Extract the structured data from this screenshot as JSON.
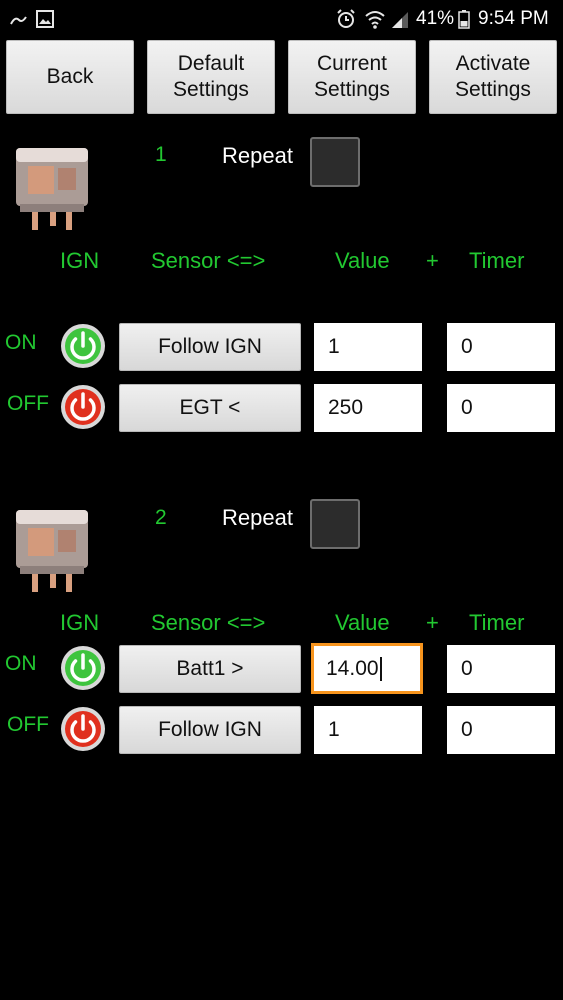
{
  "status_bar": {
    "battery_percent": "41%",
    "time": "9:54 PM",
    "icons": [
      "notification-icon",
      "image-icon",
      "alarm-icon",
      "wifi-icon",
      "signal-icon",
      "battery-icon"
    ]
  },
  "toolbar": {
    "back_label": "Back",
    "default_line1": "Default",
    "default_line2": "Settings",
    "current_line1": "Current",
    "current_line2": "Settings",
    "activate_line1": "Activate",
    "activate_line2": "Settings"
  },
  "colors": {
    "accent_green": "#22c831",
    "focus_orange": "#f7941d",
    "on_icon": "#3ec43e",
    "off_icon": "#e0301e"
  },
  "relays": [
    {
      "number": "1",
      "repeat_label": "Repeat",
      "headers": {
        "ign": "IGN",
        "sensor": "Sensor <=>",
        "value": "Value",
        "plus": "+",
        "timer": "Timer"
      },
      "on": {
        "state": "ON",
        "sensor": "Follow IGN",
        "value": "1",
        "timer": "0"
      },
      "off": {
        "state": "OFF",
        "sensor": "EGT <",
        "value": "250",
        "timer": "0"
      }
    },
    {
      "number": "2",
      "repeat_label": "Repeat",
      "headers": {
        "ign": "IGN",
        "sensor": "Sensor <=>",
        "value": "Value",
        "plus": "+",
        "timer": "Timer"
      },
      "on": {
        "state": "ON",
        "sensor": "Batt1 >",
        "value": "14.00",
        "timer": "0"
      },
      "off": {
        "state": "OFF",
        "sensor": "Follow IGN",
        "value": "1",
        "timer": "0"
      }
    }
  ]
}
